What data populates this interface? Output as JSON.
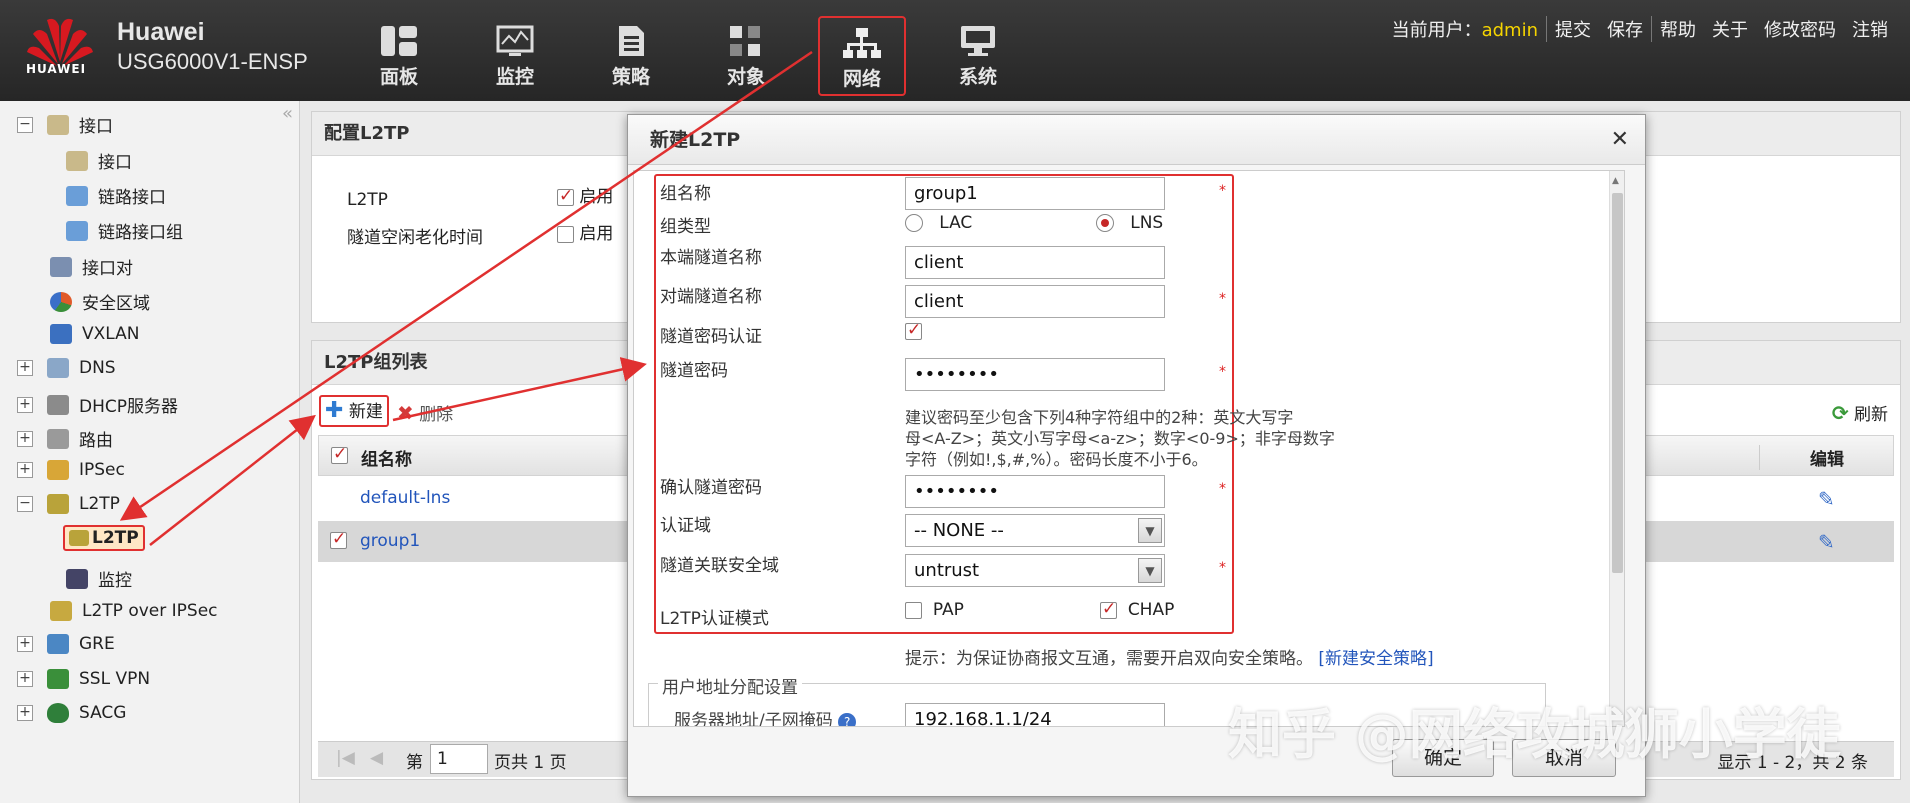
{
  "header": {
    "brand": "Huawei",
    "model": "USG6000V1-ENSP",
    "logo_text": "HUAWEI",
    "nav": [
      {
        "label": "面板",
        "icon": "dashboard-icon"
      },
      {
        "label": "监控",
        "icon": "monitor-icon"
      },
      {
        "label": "策略",
        "icon": "policy-icon"
      },
      {
        "label": "对象",
        "icon": "object-icon"
      },
      {
        "label": "网络",
        "icon": "network-icon",
        "active": true
      },
      {
        "label": "系统",
        "icon": "system-icon"
      }
    ],
    "user_label": "当前用户：",
    "username": "admin",
    "links": [
      "提交",
      "保存",
      "帮助",
      "关于",
      "修改密码",
      "注销"
    ]
  },
  "sidebar": {
    "items": [
      "接口",
      "接口",
      "链路接口",
      "链路接口组",
      "接口对",
      "安全区域",
      "VXLAN",
      "DNS",
      "DHCP服务器",
      "路由",
      "IPSec",
      "L2TP",
      "L2TP",
      "监控",
      "L2TP over IPSec",
      "GRE",
      "SSL VPN",
      "SACG"
    ]
  },
  "config_panel": {
    "title": "配置L2TP",
    "rows": [
      {
        "label": "L2TP",
        "checked": true,
        "option": "启用"
      },
      {
        "label": "隧道空闲老化时间",
        "checked": false,
        "option": "启用"
      }
    ]
  },
  "list_panel": {
    "title": "L2TP组列表",
    "new_label": "新建",
    "delete_label": "删除",
    "refresh_label": "刷新",
    "columns": {
      "name": "组名称",
      "edit": "编辑"
    },
    "rows": [
      {
        "name": "default-lns",
        "checked": false
      },
      {
        "name": "group1",
        "checked": true
      }
    ],
    "pager": {
      "prefix": "第",
      "page": "1",
      "suffix": "页共 1 页",
      "summary": "显示 1 - 2，共 2 条"
    }
  },
  "modal": {
    "title": "新建L2TP",
    "fields": {
      "group_name_label": "组名称",
      "group_name": "group1",
      "group_type_label": "组类型",
      "type_lac": "LAC",
      "type_lns": "LNS",
      "local_tunnel_label": "本端隧道名称",
      "local_tunnel": "client",
      "peer_tunnel_label": "对端隧道名称",
      "peer_tunnel": "client",
      "tunnel_auth_label": "隧道密码认证",
      "tunnel_password_label": "隧道密码",
      "tunnel_password": "••••••••",
      "password_hint_1": "建议密码至少包含下列4种字符组中的2种：英文大写字",
      "password_hint_2": "母<A-Z>；英文小写字母<a-z>；数字<0-9>；非字母数字",
      "password_hint_3": "字符（例如!,$,#,%）。密码长度不小于6。",
      "confirm_password_label": "确认隧道密码",
      "confirm_password": "••••••••",
      "auth_domain_label": "认证域",
      "auth_domain": "-- NONE --",
      "security_zone_label": "隧道关联安全域",
      "security_zone": "untrust",
      "auth_mode_label": "L2TP认证模式",
      "mode_pap": "PAP",
      "mode_chap": "CHAP",
      "tip": "提示：为保证协商报文互通，需要开启双向安全策略。",
      "tip_link": "[新建安全策略]",
      "address_section": "用户地址分配设置",
      "server_address_label": "服务器地址/子网掩码",
      "server_address": "192.168.1.1/24"
    },
    "ok_label": "确定",
    "cancel_label": "取消"
  },
  "watermark": "知乎 @网络攻城狮小学徒",
  "colors": {
    "accent": "#e03030",
    "username": "#f5d400",
    "link": "#2255bb"
  }
}
